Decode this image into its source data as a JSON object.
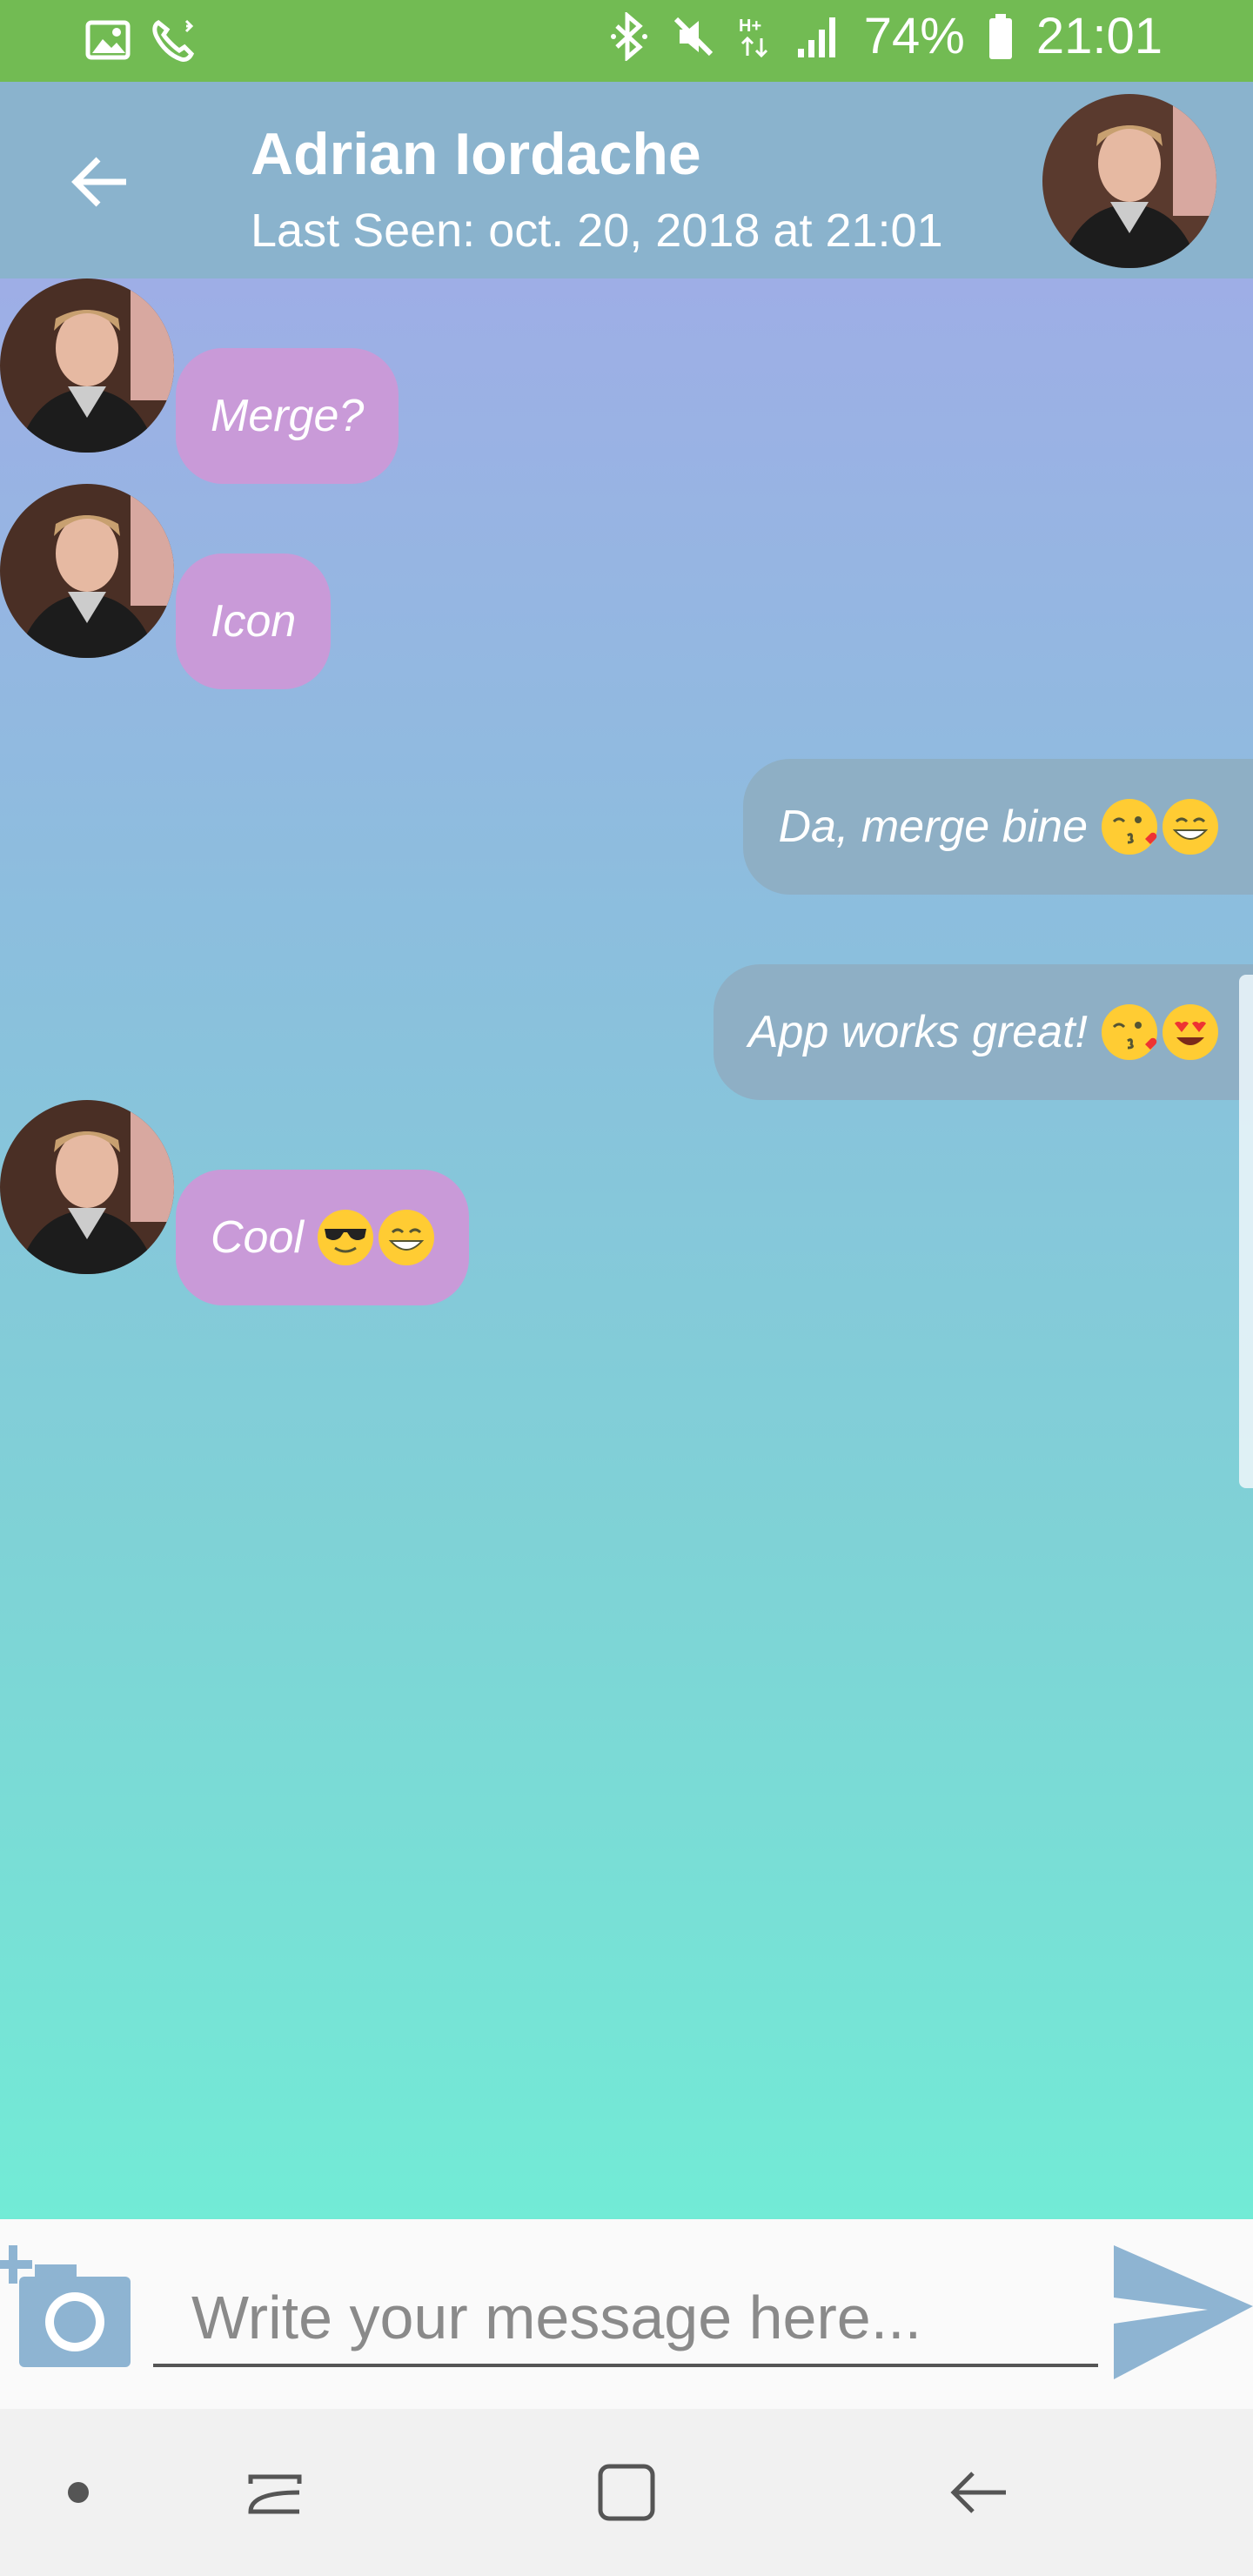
{
  "status_bar": {
    "battery": "74%",
    "time": "21:01",
    "icons": [
      "image-icon",
      "wifi-call-icon",
      "bluetooth-icon",
      "mute-icon",
      "hplus-icon",
      "signal-icon",
      "battery-icon"
    ]
  },
  "header": {
    "contact_name": "Adrian Iordache",
    "last_seen": "Last Seen: oct. 20, 2018 at 21:01",
    "back_icon": "arrow-left-icon"
  },
  "messages": [
    {
      "direction": "incoming",
      "text": "Merge?",
      "emojis": []
    },
    {
      "direction": "incoming",
      "text": "Icon",
      "emojis": []
    },
    {
      "direction": "outgoing",
      "text": "Da, merge bine",
      "emojis": [
        "kiss-emoji",
        "grin-emoji"
      ]
    },
    {
      "direction": "outgoing",
      "text": "App works great!",
      "emojis": [
        "kiss-emoji",
        "heart-eyes-emoji"
      ]
    },
    {
      "direction": "incoming",
      "text": "Cool",
      "emojis": [
        "sunglasses-emoji",
        "grin-emoji"
      ]
    }
  ],
  "composer": {
    "placeholder": "Write your message here...",
    "value": "",
    "camera_icon": "add-photo-icon",
    "send_icon": "send-icon"
  },
  "colors": {
    "status_bar": "#72bb53",
    "app_bar": "#8ab3cd",
    "incoming_bubble": "#c99ad8",
    "outgoing_bubble": "#8eafc5",
    "gradient_top": "#9eaee6",
    "gradient_bottom": "#72ebd6"
  }
}
